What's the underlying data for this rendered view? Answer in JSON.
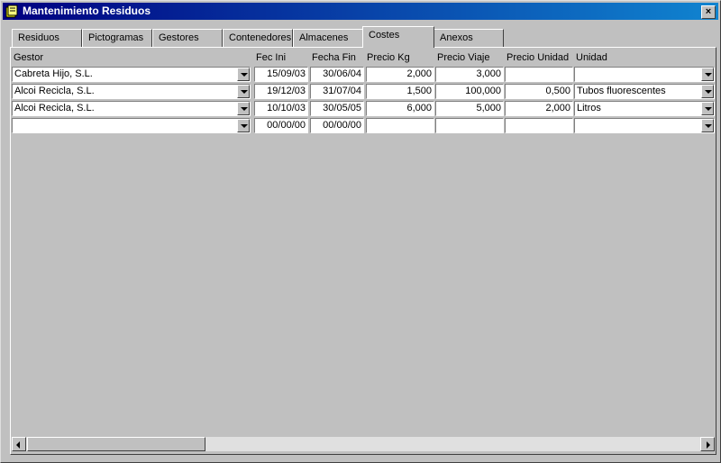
{
  "window": {
    "title": "Mantenimiento Residuos",
    "close_label": "×"
  },
  "tabs": [
    "Residuos",
    "Pictogramas",
    "Gestores",
    "Contenedores",
    "Almacenes",
    "Costes",
    "Anexos"
  ],
  "active_tab": "Costes",
  "headers": {
    "gestor": "Gestor",
    "fec_ini": "Fec Ini",
    "fecha_fin": "Fecha Fin",
    "precio_kg": "Precio Kg",
    "precio_viaje": "Precio Viaje",
    "precio_unidad": "Precio Unidad",
    "unidad": "Unidad"
  },
  "rows": [
    {
      "gestor": "Cabreta Hijo, S.L.",
      "fec_ini": "15/09/03",
      "fecha_fin": "30/06/04",
      "precio_kg": "2,000",
      "precio_viaje": "3,000",
      "precio_unidad": "",
      "unidad": ""
    },
    {
      "gestor": "Alcoi Recicla, S.L.",
      "fec_ini": "19/12/03",
      "fecha_fin": "31/07/04",
      "precio_kg": "1,500",
      "precio_viaje": "100,000",
      "precio_unidad": "0,500",
      "unidad": "Tubos fluorescentes"
    },
    {
      "gestor": "Alcoi Recicla, S.L.",
      "fec_ini": "10/10/03",
      "fecha_fin": "30/05/05",
      "precio_kg": "6,000",
      "precio_viaje": "5,000",
      "precio_unidad": "2,000",
      "unidad": "Litros"
    },
    {
      "gestor": "",
      "fec_ini": "00/00/00",
      "fecha_fin": "00/00/00",
      "precio_kg": "",
      "precio_viaje": "",
      "precio_unidad": "",
      "unidad": ""
    }
  ]
}
